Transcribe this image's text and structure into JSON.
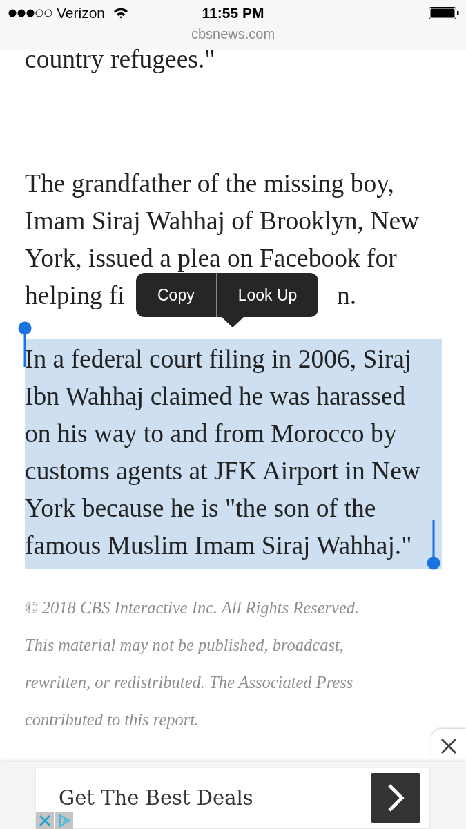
{
  "status_bar": {
    "carrier": "Verizon",
    "time": "11:55 PM"
  },
  "address_bar": {
    "url": "cbsnews.com"
  },
  "article": {
    "lead_line": "country refugees.\"",
    "paragraphs": [
      {
        "selected": false,
        "lines": [
          "The grandfather of the missing boy,",
          "Imam Siraj Wahhaj of Brooklyn, New",
          "York, issued a plea on Facebook for"
        ],
        "covered_line": {
          "before": "helping fi",
          "after": "n."
        }
      },
      {
        "selected": true,
        "lines": [
          "In a federal court filing in 2006, Siraj",
          "Ibn Wahhaj claimed he was harassed",
          "on his way to and from Morocco by",
          "customs agents at JFK Airport in New",
          "York because he is \"the son of the",
          "famous Muslim Imam Siraj Wahhaj.\""
        ]
      }
    ],
    "copyright_lines": [
      "© 2018 CBS Interactive Inc. All Rights Reserved.",
      "This material may not be published, broadcast,",
      "rewritten, or redistributed. The Associated Press",
      "contributed to this report."
    ]
  },
  "edit_menu": {
    "items": [
      "Copy",
      "Look Up"
    ]
  },
  "ad": {
    "text": "Get The Best Deals"
  }
}
